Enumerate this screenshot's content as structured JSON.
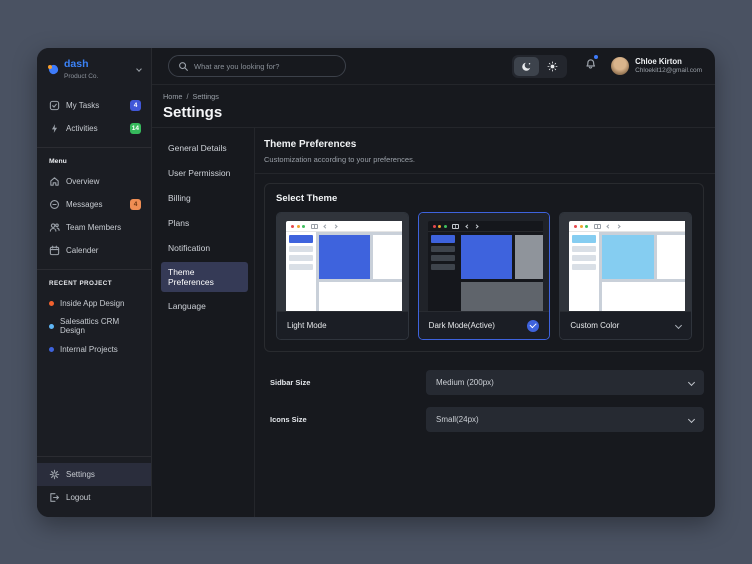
{
  "app": {
    "name": "dash",
    "company": "Product Co."
  },
  "header": {
    "search_placeholder": "What are you looking for?",
    "user_name": "Chloe Kirton",
    "user_email": "Chloekit12@gmail.com"
  },
  "breadcrumb": {
    "root": "Home",
    "separator": "/",
    "current": "Settings"
  },
  "page": {
    "title": "Settings"
  },
  "sidebar": {
    "tasks": [
      {
        "label": "My Tasks",
        "badge": "4",
        "badge_color": "#4157d8"
      },
      {
        "label": "Activities",
        "badge": "14",
        "badge_color": "#36b95c"
      }
    ],
    "menu_heading": "Menu",
    "menu": [
      {
        "label": "Overview"
      },
      {
        "label": "Messages",
        "badge": "4",
        "badge_color": "#ef8e54"
      },
      {
        "label": "Team Members"
      },
      {
        "label": "Calender"
      }
    ],
    "recent_heading": "RECENT PROJECT",
    "projects": [
      {
        "label": "Inside App Design",
        "color": "#f2612e"
      },
      {
        "label": "Salesattics CRM Design",
        "color": "#5fb6f5"
      },
      {
        "label": "Internal Projects",
        "color": "#3e63dd"
      }
    ],
    "footer": [
      {
        "label": "Settings"
      },
      {
        "label": "Logout"
      }
    ]
  },
  "settings_nav": {
    "items": [
      {
        "label": "General Details"
      },
      {
        "label": "User Permission"
      },
      {
        "label": "Billing"
      },
      {
        "label": "Plans"
      },
      {
        "label": "Notification"
      },
      {
        "label": "Theme Preferences",
        "active": true
      },
      {
        "label": "Language"
      }
    ]
  },
  "main": {
    "section_title": "Theme Preferences",
    "section_subtitle": "Customization according to your preferences.",
    "select_theme": {
      "title": "Select Theme",
      "options": [
        {
          "label": "Light Mode"
        },
        {
          "label": "Dark Mode(Active)",
          "selected": true
        },
        {
          "label": "Custom Color"
        }
      ]
    },
    "fields": [
      {
        "label": "Sidbar Size",
        "value": "Medium (200px)"
      },
      {
        "label": "Icons Size",
        "value": "Small(24px)"
      }
    ]
  },
  "colors": {
    "outer_background": "#4a5262",
    "window_background": "#17191e",
    "accent_blue": "#3e63dd",
    "custom_accent": "#85cdf1",
    "active_nav_pill": "#353a56",
    "badge_blue": "#4157d8",
    "badge_green": "#36b95c",
    "badge_orange": "#ef8e54"
  }
}
